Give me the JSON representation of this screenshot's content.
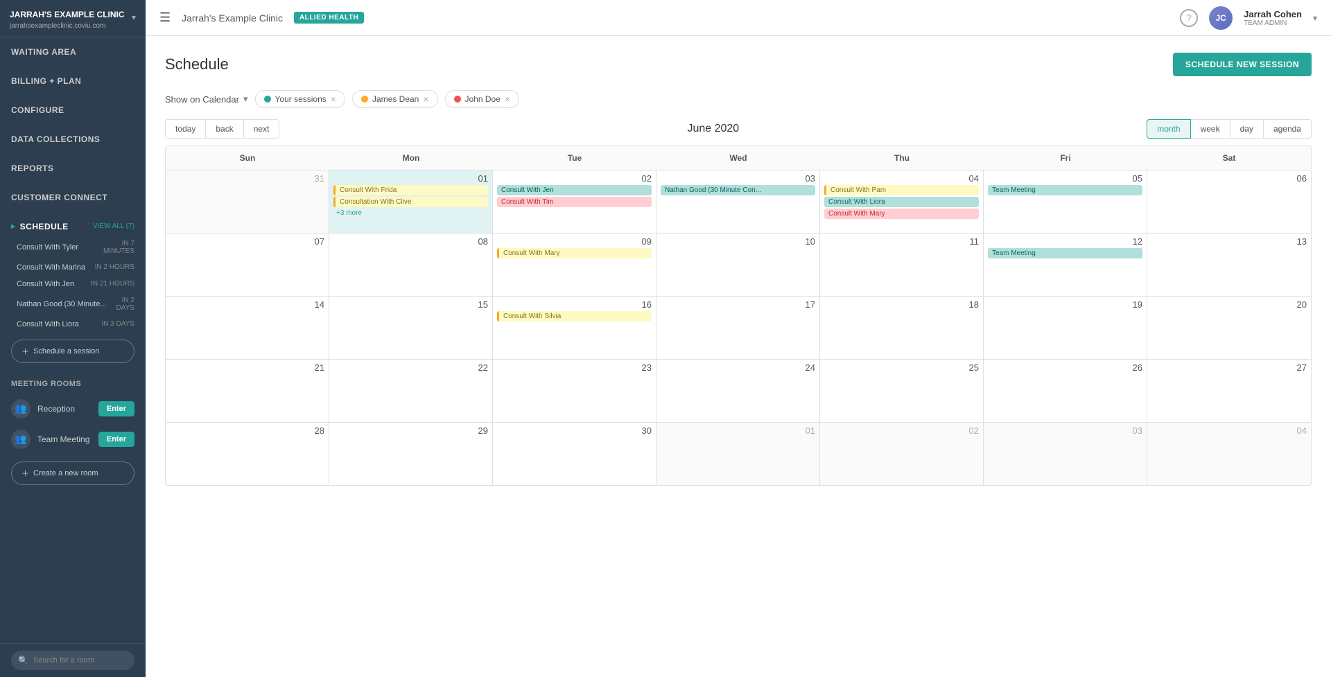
{
  "sidebar": {
    "clinic_name": "JARRAH'S EXAMPLE CLINIC",
    "clinic_url": "jarrahsexampleclinic.coviu.com",
    "nav_items": [
      {
        "id": "waiting-area",
        "label": "WAITING AREA"
      },
      {
        "id": "billing-plan",
        "label": "BILLING + PLAN"
      },
      {
        "id": "configure",
        "label": "CONFIGURE"
      },
      {
        "id": "data-collections",
        "label": "DATA COLLECTIONS"
      },
      {
        "id": "reports",
        "label": "REPORTS"
      },
      {
        "id": "customer-connect",
        "label": "CUSTOMER CONNECT"
      }
    ],
    "schedule_section": {
      "title": "SCHEDULE",
      "view_all_label": "VIEW ALL (7)",
      "items": [
        {
          "name": "Consult With Tyler",
          "time": "IN 7 MINUTES"
        },
        {
          "name": "Consult With Marina",
          "time": "IN 2 HOURS"
        },
        {
          "name": "Consult With Jen",
          "time": "IN 21 HOURS"
        },
        {
          "name": "Nathan Good (30 Minute...",
          "time": "IN 2 DAYS"
        },
        {
          "name": "Consult With Liora",
          "time": "IN 3 DAYS"
        }
      ],
      "session_btn": "Schedule a session"
    },
    "meeting_rooms": {
      "title": "MEETING ROOMS",
      "rooms": [
        {
          "name": "Reception",
          "enter_label": "Enter"
        },
        {
          "name": "Team Meeting",
          "enter_label": "Enter"
        }
      ],
      "create_room_btn": "Create a new room"
    },
    "search_placeholder": "Search for a room"
  },
  "topnav": {
    "clinic": "Jarrah's Example Clinic",
    "badge": "ALLIED HEALTH",
    "help_icon": "?",
    "user": {
      "name": "Jarrah Cohen",
      "role": "TEAM ADMIN"
    }
  },
  "schedule_page": {
    "title": "Schedule",
    "new_session_btn": "SCHEDULE NEW SESSION",
    "show_on_calendar_label": "Show on Calendar",
    "filters": [
      {
        "id": "your-sessions",
        "label": "Your sessions",
        "color": "#26a69a"
      },
      {
        "id": "james-dean",
        "label": "James Dean",
        "color": "#ffa726"
      },
      {
        "id": "john-doe",
        "label": "John Doe",
        "color": "#ef5350"
      }
    ],
    "calendar": {
      "nav_buttons": [
        "today",
        "back",
        "next"
      ],
      "current_month_label": "June 2020",
      "view_buttons": [
        "month",
        "week",
        "day",
        "agenda"
      ],
      "active_view": "month",
      "headers": [
        "Sun",
        "Mon",
        "Tue",
        "Wed",
        "Thu",
        "Fri",
        "Sat"
      ],
      "weeks": [
        {
          "days": [
            {
              "num": "31",
              "month": "other",
              "events": []
            },
            {
              "num": "01",
              "month": "current",
              "events": [
                {
                  "label": "Consult With Frida",
                  "type": "yellow"
                },
                {
                  "label": "Consultation With Clive",
                  "type": "yellow"
                }
              ],
              "more": "+3 more"
            },
            {
              "num": "02",
              "month": "current",
              "events": [
                {
                  "label": "Consult With Jen",
                  "type": "teal"
                },
                {
                  "label": "Consult With Tim",
                  "type": "salmon"
                }
              ]
            },
            {
              "num": "03",
              "month": "current",
              "events": [
                {
                  "label": "Nathan Good (30 Minute Con...",
                  "type": "teal"
                }
              ]
            },
            {
              "num": "04",
              "month": "current",
              "events": [
                {
                  "label": "Consult With Pam",
                  "type": "yellow"
                },
                {
                  "label": "Consult With Liora",
                  "type": "teal"
                },
                {
                  "label": "Consult With Mary",
                  "type": "salmon"
                }
              ]
            },
            {
              "num": "05",
              "month": "current",
              "events": [
                {
                  "label": "Team Meeting",
                  "type": "teal"
                }
              ]
            },
            {
              "num": "06",
              "month": "current",
              "events": []
            }
          ]
        },
        {
          "days": [
            {
              "num": "07",
              "month": "current",
              "events": []
            },
            {
              "num": "08",
              "month": "current",
              "events": []
            },
            {
              "num": "09",
              "month": "current",
              "events": [
                {
                  "label": "Consult With Mary",
                  "type": "yellow"
                }
              ]
            },
            {
              "num": "10",
              "month": "current",
              "events": []
            },
            {
              "num": "11",
              "month": "current",
              "events": []
            },
            {
              "num": "12",
              "month": "current",
              "events": [
                {
                  "label": "Team Meeting",
                  "type": "teal"
                }
              ]
            },
            {
              "num": "13",
              "month": "current",
              "events": []
            }
          ]
        },
        {
          "days": [
            {
              "num": "14",
              "month": "current",
              "events": []
            },
            {
              "num": "15",
              "month": "current",
              "events": []
            },
            {
              "num": "16",
              "month": "current",
              "events": [
                {
                  "label": "Consult With Silvia",
                  "type": "yellow"
                }
              ]
            },
            {
              "num": "17",
              "month": "current",
              "events": []
            },
            {
              "num": "18",
              "month": "current",
              "events": []
            },
            {
              "num": "19",
              "month": "current",
              "events": []
            },
            {
              "num": "20",
              "month": "current",
              "events": []
            }
          ]
        },
        {
          "days": [
            {
              "num": "21",
              "month": "current",
              "events": []
            },
            {
              "num": "22",
              "month": "current",
              "events": []
            },
            {
              "num": "23",
              "month": "current",
              "events": []
            },
            {
              "num": "24",
              "month": "current",
              "events": []
            },
            {
              "num": "25",
              "month": "current",
              "events": []
            },
            {
              "num": "26",
              "month": "current",
              "events": []
            },
            {
              "num": "27",
              "month": "current",
              "events": []
            }
          ]
        },
        {
          "days": [
            {
              "num": "28",
              "month": "current",
              "events": []
            },
            {
              "num": "29",
              "month": "current",
              "events": []
            },
            {
              "num": "30",
              "month": "current",
              "events": []
            },
            {
              "num": "01",
              "month": "other",
              "events": []
            },
            {
              "num": "02",
              "month": "other",
              "events": []
            },
            {
              "num": "03",
              "month": "other",
              "events": []
            },
            {
              "num": "04",
              "month": "other",
              "events": []
            }
          ]
        }
      ]
    }
  }
}
